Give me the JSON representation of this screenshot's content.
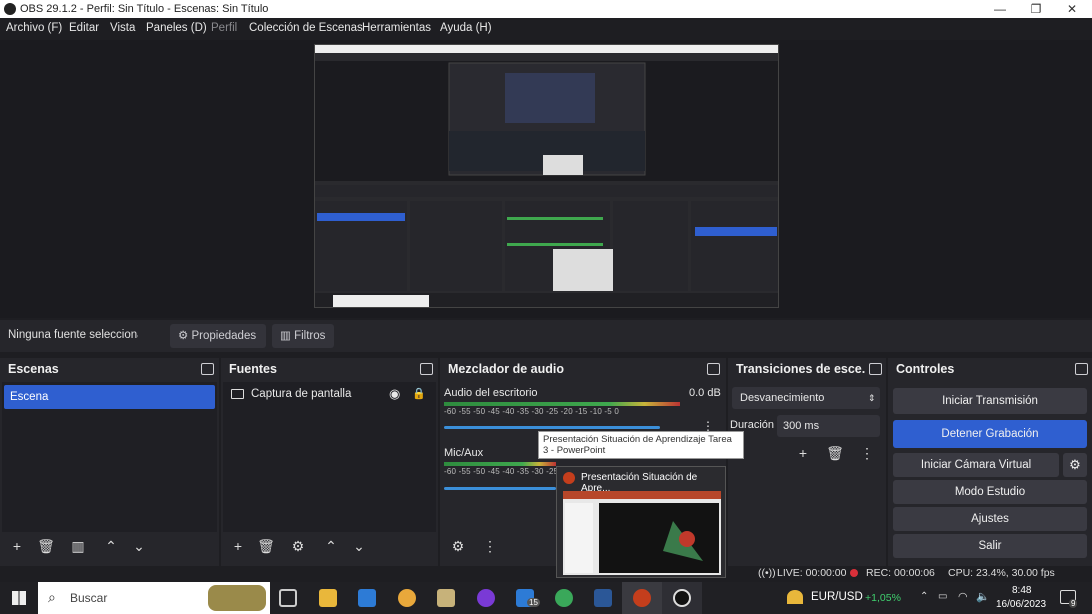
{
  "window": {
    "title": "OBS 29.1.2 - Perfil: Sin Título - Escenas: Sin Título"
  },
  "menu": [
    "Archivo (F)",
    "Editar",
    "Vista",
    "Paneles (D)",
    "Perfil",
    "Colección de Escenas",
    "Herramientas",
    "Ayuda (H)"
  ],
  "source_bar": {
    "status": "Ninguna fuente seleccionad",
    "properties": "Propiedades",
    "filters": "Filtros"
  },
  "scenes": {
    "title": "Escenas",
    "items": [
      "Escena"
    ]
  },
  "sources": {
    "title": "Fuentes",
    "items": [
      "Captura de pantalla"
    ]
  },
  "mixer": {
    "title": "Mezclador de audio",
    "channels": [
      {
        "name": "Audio del escritorio",
        "level": "0.0 dB"
      },
      {
        "name": "Mic/Aux",
        "level": ""
      }
    ],
    "ticks": "-60 -55 -50 -45 -40 -35 -30 -25 -20 -15 -10 -5 0"
  },
  "transitions": {
    "title": "Transiciones de esce...",
    "selected": "Desvanecimiento",
    "duration_label": "Duración",
    "duration_value": "300 ms"
  },
  "controls": {
    "title": "Controles",
    "buttons": [
      "Iniciar Transmisión",
      "Detener Grabación",
      "Iniciar Cámara Virtual",
      "Modo Estudio",
      "Ajustes",
      "Salir"
    ]
  },
  "tooltip": {
    "text": "Presentación Situación de Aprendizaje Tarea 3 - PowerPoint"
  },
  "thumbnail": {
    "title": "Presentación Situación de Apre..."
  },
  "status": {
    "live": "LIVE: 00:00:00",
    "rec": "REC: 00:00:06",
    "cpu": "CPU: 23.4%, 30.00 fps"
  },
  "taskbar": {
    "search_placeholder": "Buscar",
    "ticker": "EUR/USD",
    "change": "+1,05%",
    "time": "8:48",
    "date": "16/06/2023",
    "notif": "9",
    "mail_badge": "15"
  },
  "colors": {
    "accent": "#2f5fd0",
    "bg": "#1e1e22",
    "dock": "#26262b"
  }
}
